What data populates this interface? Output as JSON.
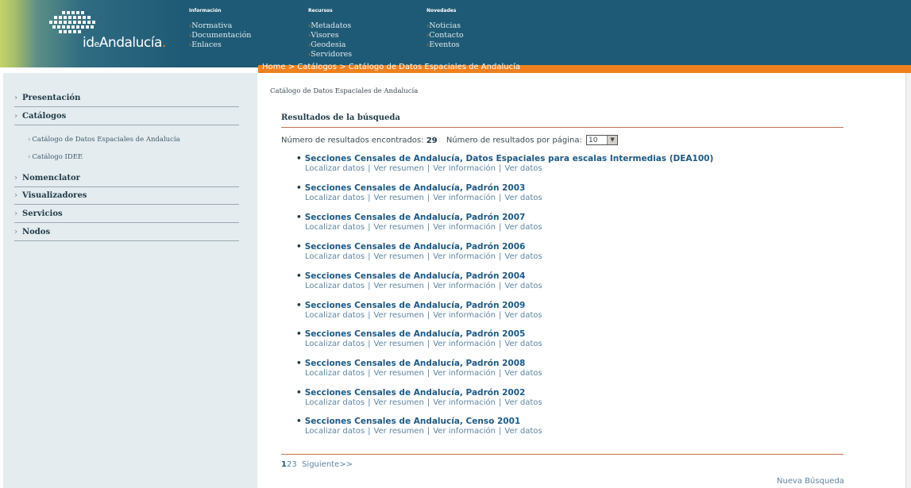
{
  "header": {
    "logo_text_main": "id",
    "logo_text_e": "e",
    "logo_text_rest": "Andalucía",
    "logo_dot": ".",
    "menus": [
      {
        "heading": "Información",
        "items": [
          "Normativa",
          "Documentación",
          "Enlaces"
        ]
      },
      {
        "heading": "Recursos",
        "items": [
          "Metadatos",
          "Visores",
          "Geodesia",
          "Servidores"
        ]
      },
      {
        "heading": "Novedades",
        "items": [
          "Noticias",
          "Contacto",
          "Eventos"
        ]
      }
    ]
  },
  "breadcrumb": {
    "home": "Home",
    "sep": " > ",
    "catalogos": "Catálogos",
    "current": "Catálogo de Datos Espaciales de Andalucía"
  },
  "sidebar": {
    "items": [
      {
        "label": "Presentación"
      },
      {
        "label": "Catálogos"
      },
      {
        "label": "Nomenclator"
      },
      {
        "label": "Visualizadores"
      },
      {
        "label": "Servicios"
      },
      {
        "label": "Nodos"
      }
    ],
    "sub_items": [
      "Catálogo de Datos Espaciales de Andalucía",
      "Catálogo IDEE"
    ]
  },
  "main": {
    "title": "Catálogo de Datos Espaciales de Andalucía",
    "results_heading": "Resultados de la búsqueda",
    "count_label": "Número de resultados encontrados:",
    "count_value": "29",
    "per_page_label": "Número de resultados por página:",
    "per_page_value": "10",
    "link_labels": [
      "Localizar datos",
      "Ver resumen",
      "Ver información",
      "Ver datos"
    ],
    "results": [
      {
        "title": "Secciones Censales de Andalucía, Datos Espaciales para escalas Intermedias (DEA100)"
      },
      {
        "title": "Secciones Censales de Andalucía, Padrón 2003"
      },
      {
        "title": "Secciones Censales de Andalucía, Padrón 2007"
      },
      {
        "title": "Secciones Censales de Andalucía, Padrón 2006"
      },
      {
        "title": "Secciones Censales de Andalucía, Padrón 2004"
      },
      {
        "title": "Secciones Censales de Andalucía, Padrón 2009"
      },
      {
        "title": "Secciones Censales de Andalucía, Padrón 2005"
      },
      {
        "title": "Secciones Censales de Andalucía, Padrón 2008"
      },
      {
        "title": "Secciones Censales de Andalucía, Padrón 2002"
      },
      {
        "title": "Secciones Censales de Andalucía, Censo 2001"
      }
    ],
    "pagination": {
      "pages": [
        "1",
        "2",
        "3"
      ],
      "current": "1",
      "next": "Siguiente>>"
    },
    "new_search": "Nueva Búsqueda"
  },
  "colors": {
    "header_bg": "#1e5a75",
    "accent_orange": "#f0801e",
    "sidebar_bg": "#e4ecf0",
    "link_blue": "#1d5a84"
  }
}
